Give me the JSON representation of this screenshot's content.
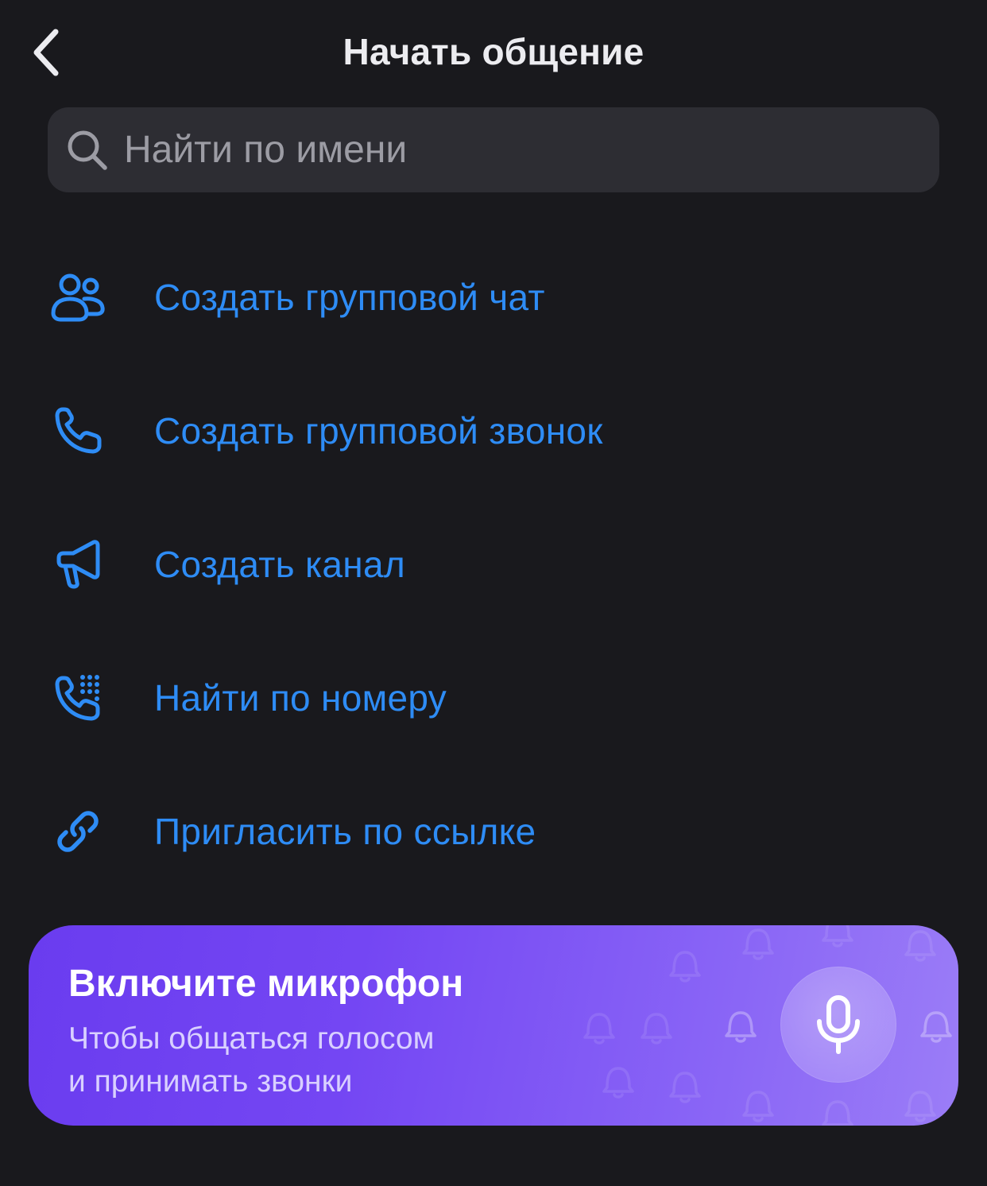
{
  "header": {
    "title": "Начать общение",
    "back_icon": "chevron-left-icon"
  },
  "search": {
    "placeholder": "Найти по имени",
    "value": "",
    "icon": "search-icon"
  },
  "menu": {
    "items": [
      {
        "label": "Создать групповой чат",
        "icon": "group-icon"
      },
      {
        "label": "Создать групповой звонок",
        "icon": "phone-icon"
      },
      {
        "label": "Создать канал",
        "icon": "megaphone-icon"
      },
      {
        "label": "Найти по номеру",
        "icon": "dialpad-phone-icon"
      },
      {
        "label": "Пригласить по ссылке",
        "icon": "link-icon"
      }
    ]
  },
  "banner": {
    "title": "Включите микрофон",
    "subtitle_line1": "Чтобы общаться голосом",
    "subtitle_line2": "и принимать звонки",
    "icon": "microphone-icon"
  },
  "colors": {
    "background": "#19191d",
    "accent": "#2e8cf5",
    "search_bg": "#2d2d33",
    "banner_start": "#6a3cef",
    "banner_end": "#9b7df7"
  }
}
